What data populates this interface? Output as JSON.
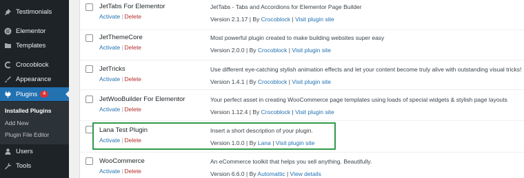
{
  "sidebar": {
    "items": [
      {
        "label": "Testimonials",
        "icon": "pin-icon"
      },
      {
        "label": "Elementor",
        "icon": "elementor-icon"
      },
      {
        "label": "Templates",
        "icon": "folder-icon"
      },
      {
        "label": "Crocoblock",
        "icon": "crocoblock-icon"
      },
      {
        "label": "Appearance",
        "icon": "paintbrush-icon"
      },
      {
        "label": "Plugins",
        "icon": "plugin-icon",
        "badge": "4"
      },
      {
        "label": "Users",
        "icon": "users-icon"
      },
      {
        "label": "Tools",
        "icon": "wrench-icon"
      }
    ],
    "submenu": [
      {
        "label": "Installed Plugins"
      },
      {
        "label": "Add New"
      },
      {
        "label": "Plugin File Editor"
      }
    ]
  },
  "plugins": [
    {
      "name": "JetTabs For Elementor",
      "activate": "Activate",
      "delete": "Delete",
      "description": "JetTabs - Tabs and Accordions for Elementor Page Builder",
      "version": "Version 2.1.17",
      "by": "By",
      "author": "Crocoblock",
      "visit": "Visit plugin site"
    },
    {
      "name": "JetThemeCore",
      "activate": "Activate",
      "delete": "Delete",
      "description": "Most powerful plugin created to make building websites super easy",
      "version": "Version 2.0.0",
      "by": "By",
      "author": "Crocoblock",
      "visit": "Visit plugin site"
    },
    {
      "name": "JetTricks",
      "activate": "Activate",
      "delete": "Delete",
      "description": "Use different eye-catching stylish animation effects and let your content become truly alive with outstanding visual tricks!",
      "version": "Version 1.4.1",
      "by": "By",
      "author": "Crocoblock",
      "visit": "Visit plugin site"
    },
    {
      "name": "JetWooBuilder For Elementor",
      "activate": "Activate",
      "delete": "Delete",
      "description": "Your perfect asset in creating WooCommerce page templates using loads of special widgets & stylish page layouts",
      "version": "Version 1.12.4",
      "by": "By",
      "author": "Crocoblock",
      "visit": "Visit plugin site"
    },
    {
      "name": "Lana Test Plugin",
      "activate": "Activate",
      "delete": "Delete",
      "description": "Insert a short description of your plugin.",
      "version": "Version 1.0.0",
      "by": "By",
      "author": "Lana",
      "visit": "Visit plugin site"
    },
    {
      "name": "WooCommerce",
      "activate": "Activate",
      "delete": "Delete",
      "description": "An eCommerce toolkit that helps you sell anything. Beautifully.",
      "version": "Version 6.6.0",
      "by": "By",
      "author": "Automattic",
      "visit": "View details"
    }
  ],
  "colors": {
    "sidebar": "#1d2327",
    "active": "#2271b1",
    "link": "#2271b1",
    "delete": "#b32d2e",
    "highlight": "#2e9a4a"
  }
}
